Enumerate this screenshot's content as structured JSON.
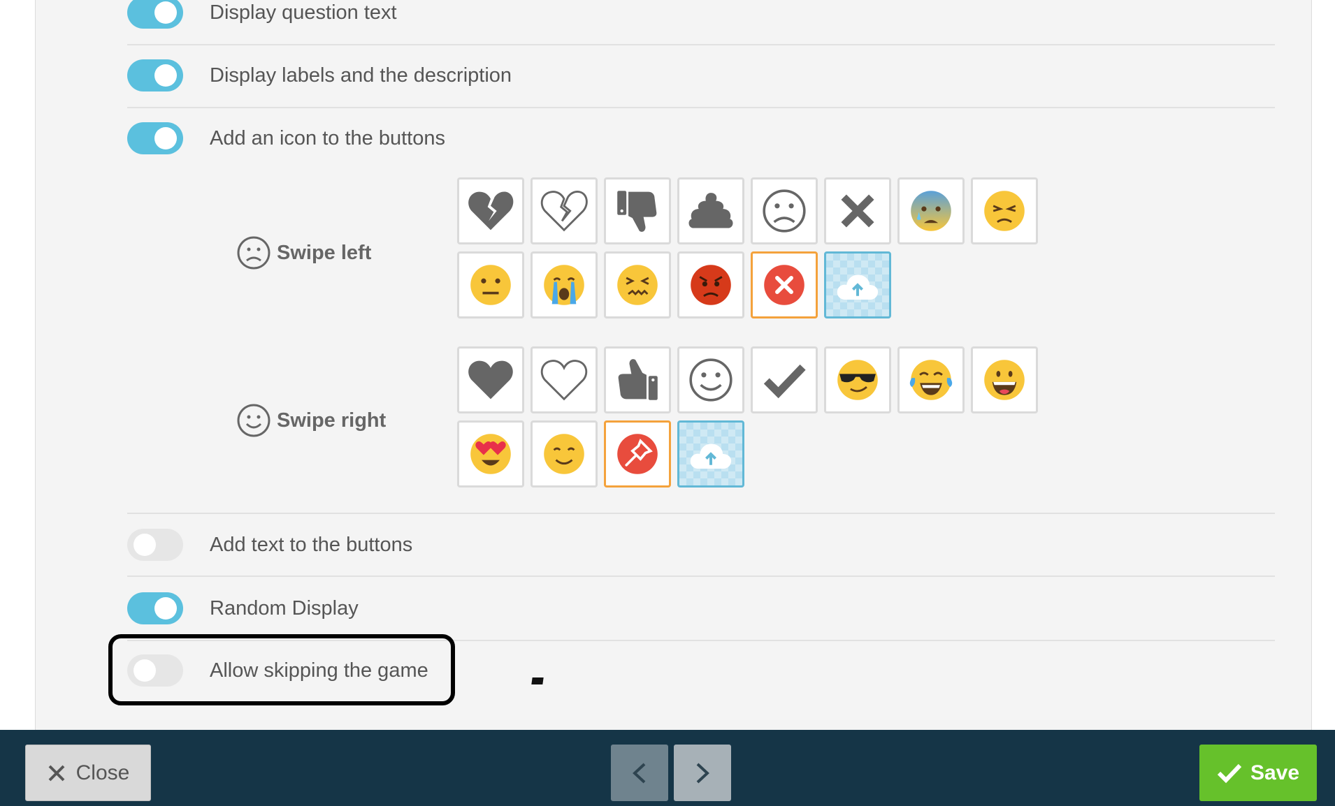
{
  "settings": {
    "display_question_text": "Display question text",
    "display_labels": "Display labels and the description",
    "add_icon": "Add an icon to the buttons",
    "add_text": "Add text to the buttons",
    "random_display": "Random Display",
    "allow_skipping": "Allow skipping the game"
  },
  "swipe_left": {
    "label": "Swipe left",
    "icons": [
      "broken-heart-filled-icon",
      "broken-heart-outline-icon",
      "thumbs-down-icon",
      "poop-icon",
      "sad-face-outline-icon",
      "cross-icon",
      "anxious-face-emoji",
      "persevering-face-emoji",
      "neutral-face-emoji",
      "crying-face-emoji",
      "confounded-face-emoji",
      "angry-face-emoji",
      "red-x-circle-icon",
      "upload-image-icon"
    ],
    "selected": "red-x-circle-icon"
  },
  "swipe_right": {
    "label": "Swipe right",
    "icons": [
      "heart-filled-icon",
      "heart-outline-icon",
      "thumbs-up-icon",
      "smile-face-outline-icon",
      "checkmark-icon",
      "sunglasses-face-emoji",
      "tears-of-joy-emoji",
      "grinning-face-emoji",
      "heart-eyes-emoji",
      "smiling-face-emoji",
      "red-pin-circle-icon",
      "upload-image-icon"
    ],
    "selected": "red-pin-circle-icon"
  },
  "footer": {
    "close_label": "Close",
    "save_label": "Save"
  },
  "colors": {
    "toggle_on": "#5bc0de",
    "toggle_off": "#e6e6e6",
    "footer_bg": "#153547",
    "save_green": "#66c12b",
    "selected_border": "#f4a23c"
  }
}
